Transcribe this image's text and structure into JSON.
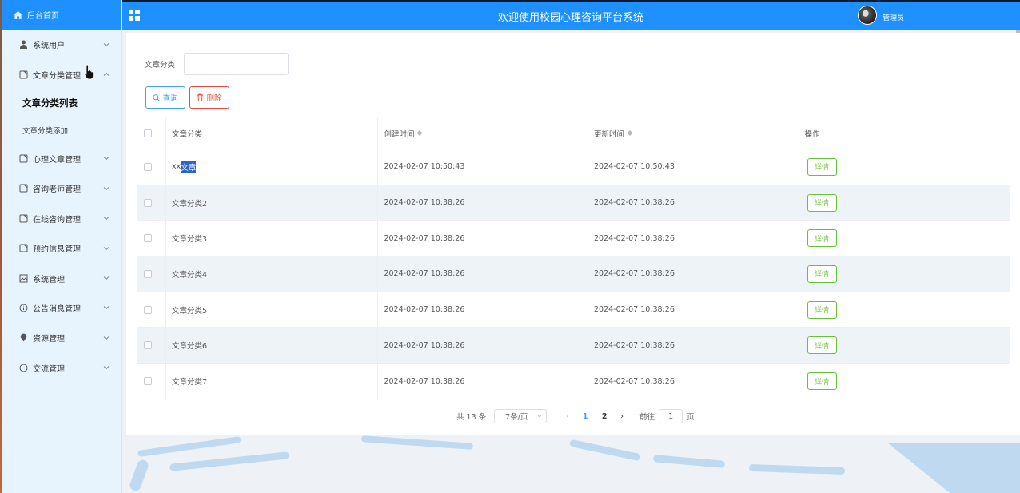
{
  "header": {
    "title": "欢迎使用校园心理咨询平台系统",
    "admin": "管理员"
  },
  "sidebar": {
    "home": "后台首页",
    "items": [
      {
        "label": "系统用户",
        "icon": "user-icon",
        "expanded": false
      },
      {
        "label": "文章分类管理",
        "icon": "doc-icon",
        "expanded": true,
        "children": [
          {
            "label": "文章分类列表",
            "active": true
          },
          {
            "label": "文章分类添加",
            "active": false
          }
        ]
      },
      {
        "label": "心理文章管理",
        "icon": "doc-icon",
        "expanded": false
      },
      {
        "label": "咨询老师管理",
        "icon": "doc-icon",
        "expanded": false
      },
      {
        "label": "在线咨询管理",
        "icon": "doc-icon",
        "expanded": false
      },
      {
        "label": "预约信息管理",
        "icon": "doc-icon",
        "expanded": false
      },
      {
        "label": "系统管理",
        "icon": "image-icon",
        "expanded": false
      },
      {
        "label": "公告消息管理",
        "icon": "info-icon",
        "expanded": false
      },
      {
        "label": "资源管理",
        "icon": "pin-icon",
        "expanded": false
      },
      {
        "label": "交流管理",
        "icon": "chat-icon",
        "expanded": false
      }
    ]
  },
  "search": {
    "label": "文章分类",
    "value": "",
    "query_btn": "查询",
    "delete_btn": "删除"
  },
  "table": {
    "columns": [
      "文章分类",
      "创建时间",
      "更新时间",
      "操作"
    ],
    "detail_label": "详情",
    "rows": [
      {
        "name_pre": "xx",
        "name_sel": "文章",
        "created": "2024-02-07 10:50:43",
        "updated": "2024-02-07 10:50:43"
      },
      {
        "name": "文章分类2",
        "created": "2024-02-07 10:38:26",
        "updated": "2024-02-07 10:38:26"
      },
      {
        "name": "文章分类3",
        "created": "2024-02-07 10:38:26",
        "updated": "2024-02-07 10:38:26"
      },
      {
        "name": "文章分类4",
        "created": "2024-02-07 10:38:26",
        "updated": "2024-02-07 10:38:26"
      },
      {
        "name": "文章分类5",
        "created": "2024-02-07 10:38:26",
        "updated": "2024-02-07 10:38:26"
      },
      {
        "name": "文章分类6",
        "created": "2024-02-07 10:38:26",
        "updated": "2024-02-07 10:38:26"
      },
      {
        "name": "文章分类7",
        "created": "2024-02-07 10:38:26",
        "updated": "2024-02-07 10:38:26"
      }
    ]
  },
  "pagination": {
    "total": "共 13 条",
    "page_size": "7条/页",
    "pages": [
      "1",
      "2"
    ],
    "current": "1",
    "goto_label": "前往",
    "goto_value": "1",
    "page_suffix": "页"
  },
  "colors": {
    "primary": "#1e90ff",
    "sidebar_bg": "#e8f4fd",
    "detail_green": "#67c23a",
    "delete_red": "#e74c3c"
  }
}
